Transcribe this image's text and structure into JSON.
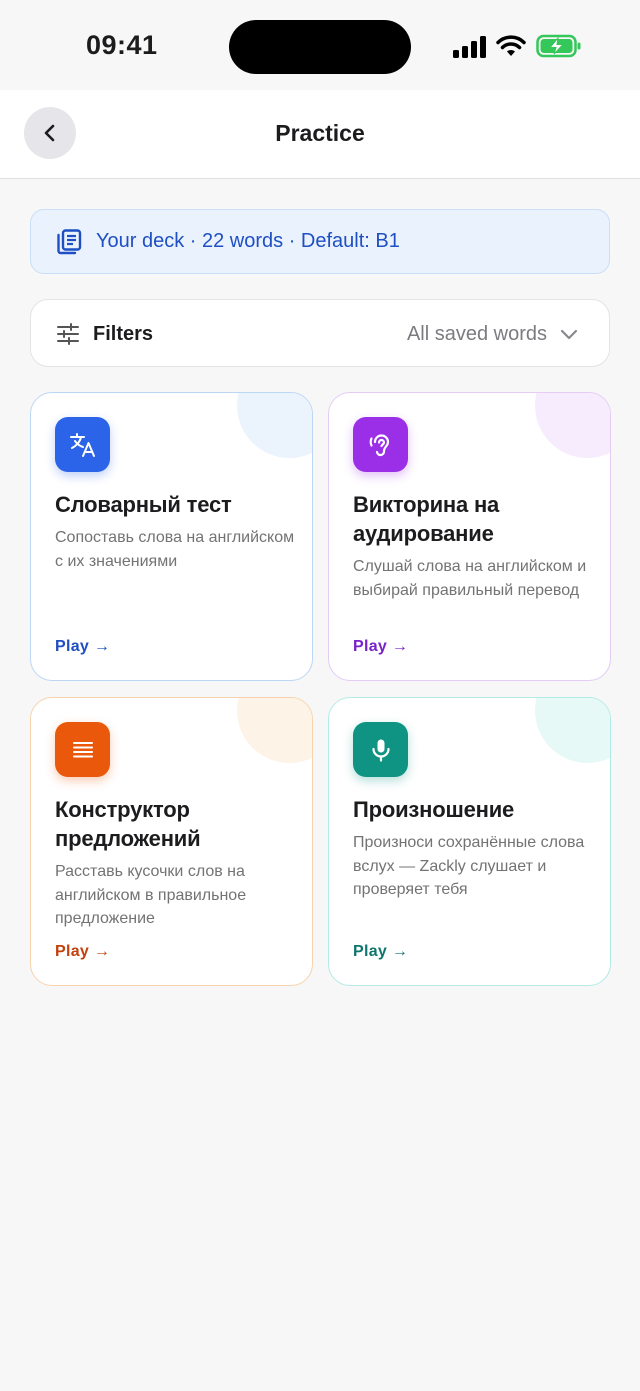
{
  "status_bar": {
    "time": "09:41"
  },
  "header": {
    "title": "Practice"
  },
  "deck": {
    "text": "Your deck · 22 words · Default: B1"
  },
  "filters": {
    "label": "Filters",
    "value": "All saved words"
  },
  "cards": [
    {
      "title": "Словарный тест",
      "description": "Сопоставь слова на английском с их значениями",
      "play_label": "Play →",
      "icon": "translate-icon",
      "accent": "#2b64e8",
      "play_color": "#1f4fc2"
    },
    {
      "title": "Викторина на аудирование",
      "description": "Слушай слова на английском и выбирай правильный перевод",
      "play_label": "Play →",
      "icon": "ear-icon",
      "accent": "#9b2fe8",
      "play_color": "#7a22c9"
    },
    {
      "title": "Конструктор предложений",
      "description": "Расставь кусочки слов на английском в правильное предложение",
      "play_label": "Play →",
      "icon": "text-lines-icon",
      "accent": "#ea580c",
      "play_color": "#c2410c"
    },
    {
      "title": "Произношение",
      "description": "Произноси сохранённые слова вслух — Zackly слушает и проверяет тебя",
      "play_label": "Play →",
      "icon": "microphone-icon",
      "accent": "#0f9484",
      "play_color": "#0f766e"
    }
  ]
}
